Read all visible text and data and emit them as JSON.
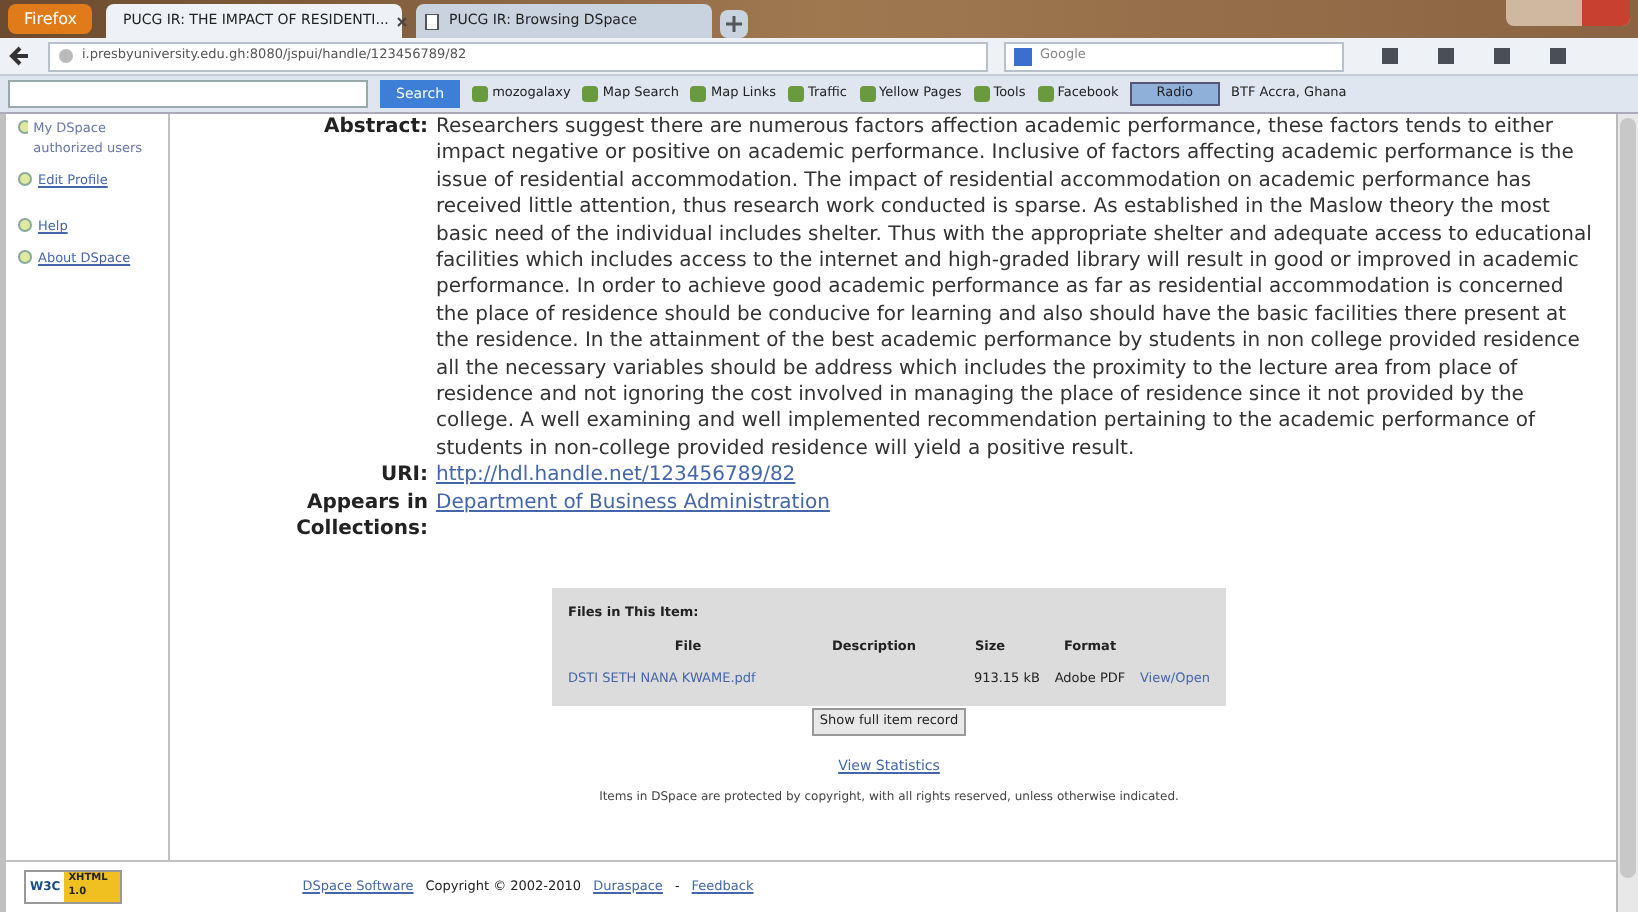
{
  "browser": {
    "menu_button": "Firefox",
    "tabs": [
      {
        "title": "PUCG IR: THE IMPACT OF RESIDENTI...",
        "selected": true
      },
      {
        "title": "PUCG IR: Browsing DSpace",
        "selected": false
      }
    ],
    "url": "i.presbyuniversity.edu.gh:8080/jspui/handle/123456789/82",
    "search_engine": "Google"
  },
  "toolbar": {
    "search_button": "Search",
    "items": [
      "mozogalaxy",
      "Map Search",
      "Map Links",
      "Traffic",
      "Yellow Pages",
      "Tools",
      "Facebook"
    ],
    "radio": "Radio",
    "station": "BTF Accra, Ghana"
  },
  "sidebar": {
    "items": [
      {
        "label": "My DSpace authorized users",
        "kind": "text"
      },
      {
        "label": "Edit Profile",
        "kind": "link"
      },
      {
        "label": "Help",
        "kind": "link"
      },
      {
        "label": "About DSpace",
        "kind": "link"
      }
    ]
  },
  "item": {
    "fields": [
      {
        "label": "Abstract:",
        "value": "Researchers suggest there are numerous factors affection academic performance, these factors tends to either impact negative or positive on academic performance. Inclusive of factors affecting academic performance is the issue of residential accommodation. The impact of residential accommodation on academic performance has received little attention, thus research work conducted is sparse. As established in the Maslow theory the most basic need of the individual includes shelter. Thus with the appropriate shelter and adequate access to educational facilities which includes access to the internet and high-graded library will result in good or improved in academic performance. In order to achieve good academic performance as far as residential accommodation is concerned the place of residence should be conducive for learning and also should have the basic facilities there present at the residence. In the attainment of the best academic performance by students in non  college provided residence all the necessary variables should be address which includes the proximity to the lecture area from place of residence and not ignoring the cost involved in managing the place of residence since it not provided by the college. A well examining and well implemented recommendation pertaining to the academic performance of students in non-college provided residence will yield a positive result.",
        "kind": "text"
      },
      {
        "label": "URI:",
        "value": "http://hdl.handle.net/123456789/82",
        "kind": "link"
      },
      {
        "label": "Appears in Collections:",
        "value": "Department of Business Administration",
        "kind": "link"
      }
    ]
  },
  "files": {
    "title": "Files in This Item:",
    "columns": [
      "File",
      "Description",
      "Size",
      "Format"
    ],
    "rows": [
      {
        "file": "DSTI SETH NANA KWAME.pdf",
        "description": "",
        "size": "913.15 kB",
        "format": "Adobe PDF",
        "action": "View/Open"
      }
    ]
  },
  "show_full_button": "Show full item record",
  "statistics_link": "View Statistics",
  "copyright_notice": "Items in DSpace are protected by copyright, with all rights reserved, unless otherwise indicated.",
  "footer": {
    "badge_left": "W3C",
    "badge_right": "XHTML 1.0",
    "software_link": "DSpace Software",
    "copyright": "Copyright © 2002-2010",
    "duraspace_link": "Duraspace",
    "separator": "-",
    "feedback_link": "Feedback"
  }
}
